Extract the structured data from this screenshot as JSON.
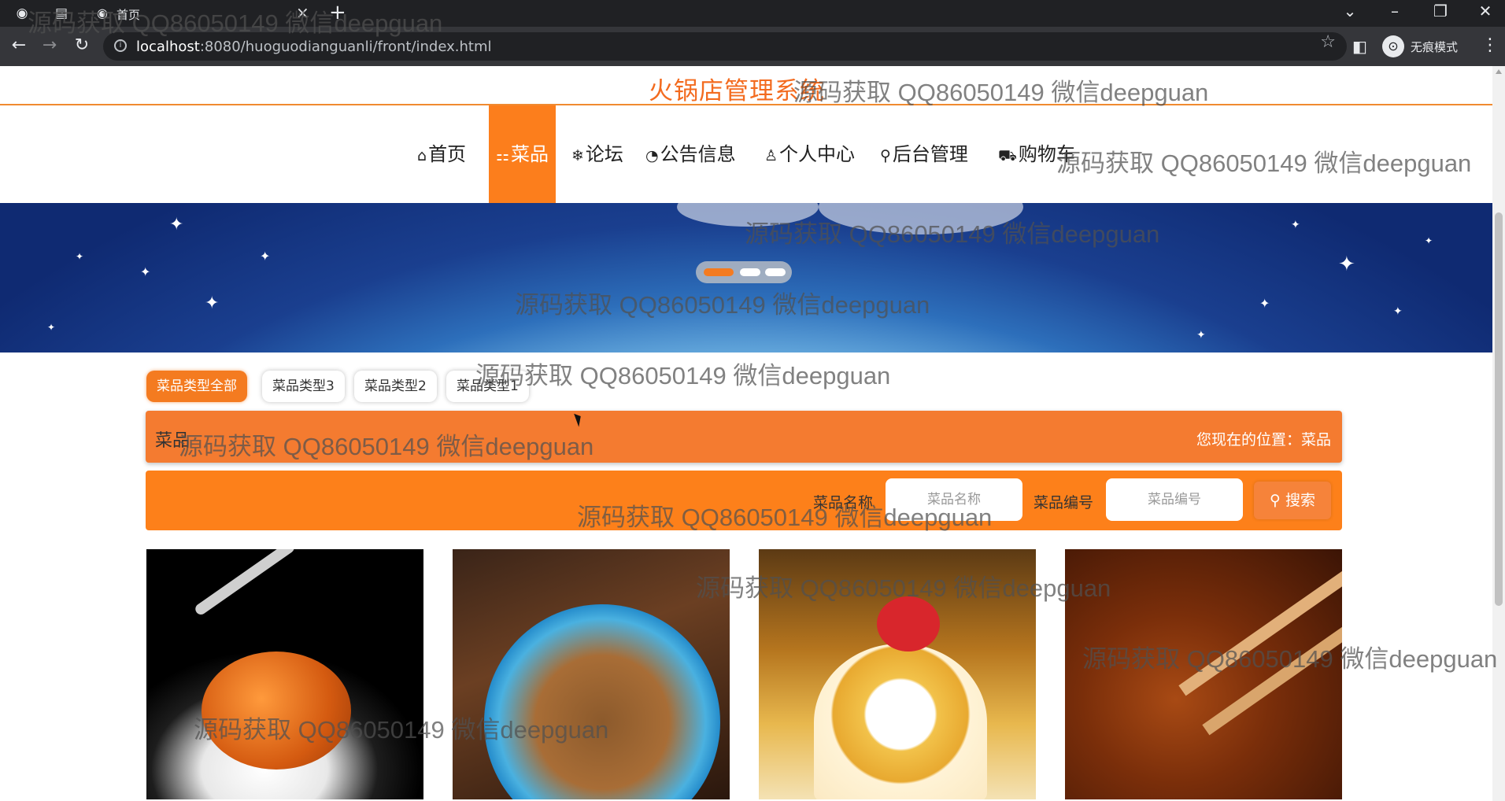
{
  "browser": {
    "tab_title": "首页",
    "tab_favicon": "globe-icon",
    "url_host": "localhost",
    "url_rest": ":8080/huoguodianguanli/front/index.html",
    "incognito_label": "无痕模式"
  },
  "site": {
    "title": "火锅店管理系统"
  },
  "nav": {
    "items": [
      {
        "label": "首页",
        "icon": "home-icon",
        "glyph": "⌂"
      },
      {
        "label": "菜品",
        "icon": "dish-icon",
        "glyph": "⚏",
        "active": true
      },
      {
        "label": "论坛",
        "icon": "snowflake-icon",
        "glyph": "❄"
      },
      {
        "label": "公告信息",
        "icon": "palette-icon",
        "glyph": "◔"
      },
      {
        "label": "个人中心",
        "icon": "user-icon",
        "glyph": "♙"
      },
      {
        "label": "后台管理",
        "icon": "link-icon",
        "glyph": "⚲"
      },
      {
        "label": "购物车",
        "icon": "cart-icon",
        "glyph": "⛟"
      }
    ]
  },
  "banner": {
    "slide_count": 3,
    "active_slide": 1
  },
  "filters": {
    "chips": [
      "菜品类型全部",
      "菜品类型3",
      "菜品类型2",
      "菜品类型1"
    ],
    "active_index": 0
  },
  "breadcrumb": {
    "page": "菜品",
    "location": "您现在的位置：菜品"
  },
  "search": {
    "name_label": "菜品名称",
    "name_placeholder": "菜品名称",
    "code_label": "菜品编号",
    "code_placeholder": "菜品编号",
    "button": "搜索"
  },
  "products": [
    {
      "image": "seafood-dish-photo"
    },
    {
      "image": "fried-noodles-photo"
    },
    {
      "image": "cake-roll-photo"
    },
    {
      "image": "grilled-meat-photo"
    }
  ],
  "watermark": "源码获取 QQ86050149 微信deepguan",
  "colors": {
    "accent": "#f47b20",
    "nav_active": "#fc7e1c",
    "search_bar": "#fd801a",
    "breadcrumb_bar": "#f47b30",
    "title": "#f36b1f"
  }
}
